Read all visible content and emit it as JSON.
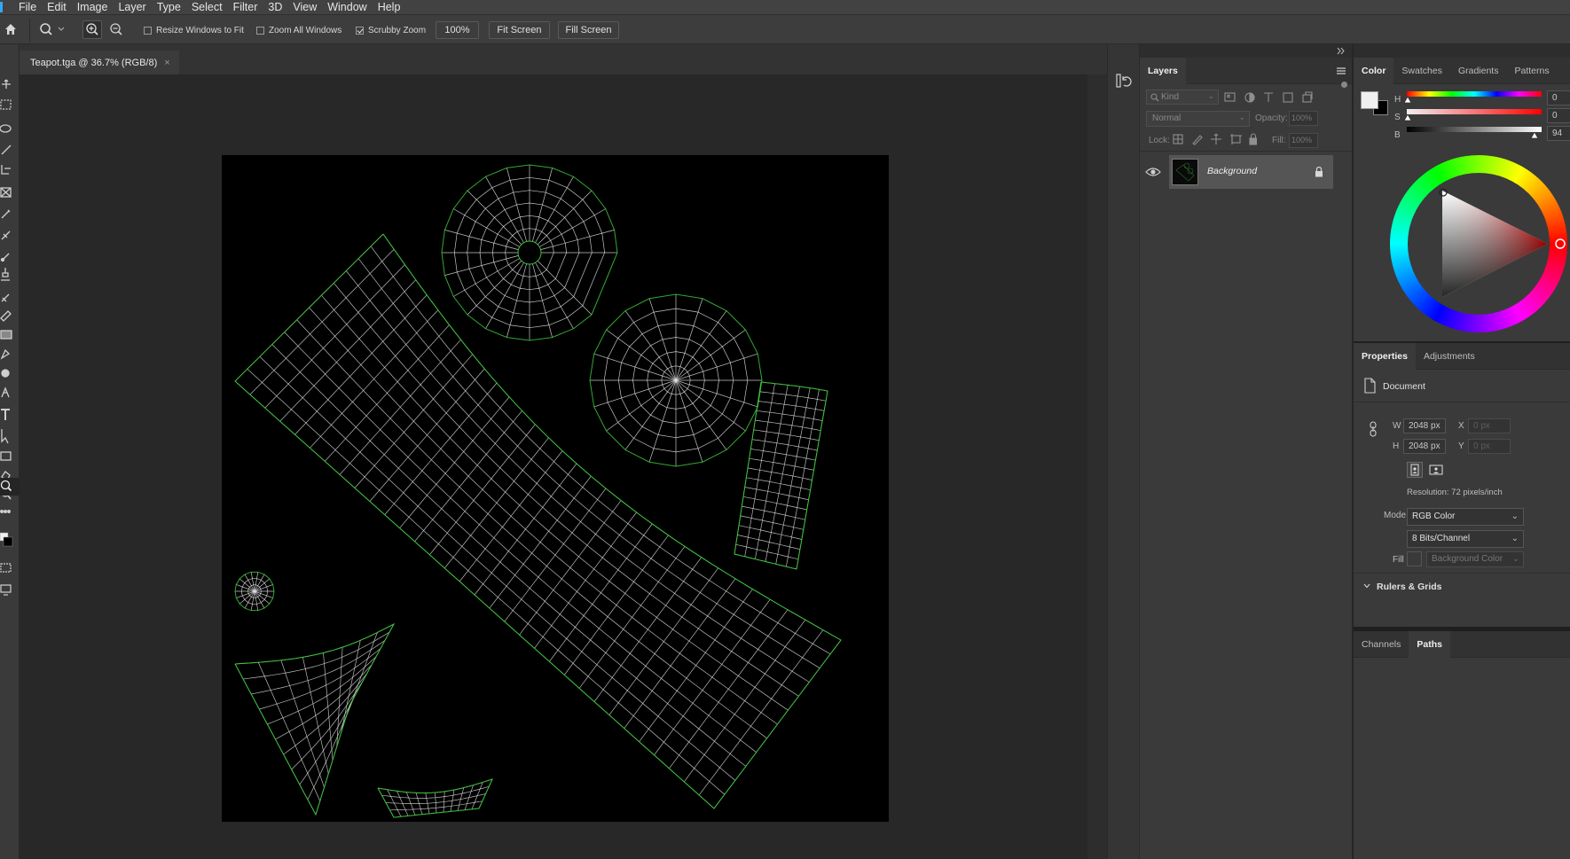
{
  "menu": [
    "File",
    "Edit",
    "Image",
    "Layer",
    "Type",
    "Select",
    "Filter",
    "3D",
    "View",
    "Window",
    "Help"
  ],
  "options_bar": {
    "resize_windows": "Resize Windows to Fit",
    "zoom_all": "Zoom All Windows",
    "scrubby_zoom": "Scrubby Zoom",
    "zoom_value": "100%",
    "fit_screen": "Fit Screen",
    "fill_screen": "Fill Screen",
    "resize_checked": false,
    "zoom_all_checked": false,
    "scrubby_checked": true
  },
  "document": {
    "tab_title": "Teapot.tga @ 36.7% (RGB/8)",
    "close_glyph": "×"
  },
  "layers_panel": {
    "tab": "Layers",
    "kind_filter": "Kind",
    "blend_mode": "Normal",
    "opacity_label": "Opacity:",
    "opacity_value": "100%",
    "lock_label": "Lock:",
    "fill_label": "Fill:",
    "fill_value": "100%",
    "layers": [
      {
        "name": "Background",
        "visible": true,
        "locked": true
      }
    ]
  },
  "color_panel": {
    "tabs": [
      "Color",
      "Swatches",
      "Gradients",
      "Patterns"
    ],
    "h_label": "H",
    "h_value": "0",
    "s_label": "S",
    "s_value": "0",
    "b_label": "B",
    "b_value": "94",
    "foreground": "#f0f0f0",
    "background": "#000000"
  },
  "properties_panel": {
    "tabs": [
      "Properties",
      "Adjustments"
    ],
    "section": "Document",
    "w_label": "W",
    "w_value": "2048 px",
    "h_label": "H",
    "h_value": "2048 px",
    "x_label": "X",
    "x_value": "0 px",
    "y_label": "Y",
    "y_value": "0 px",
    "resolution": "Resolution: 72 pixels/inch",
    "mode_label": "Mode",
    "mode_value": "RGB Color",
    "depth_value": "8 Bits/Channel",
    "fill_label": "Fill",
    "fill_value": "Background Color",
    "rulers_section": "Rulers & Grids"
  },
  "channels_panel": {
    "tabs": [
      "Channels",
      "Paths"
    ]
  },
  "colors": {
    "uv_edge": "#3cc33c",
    "uv_line": "#e8e8e8",
    "accent": "#31a8ff"
  }
}
